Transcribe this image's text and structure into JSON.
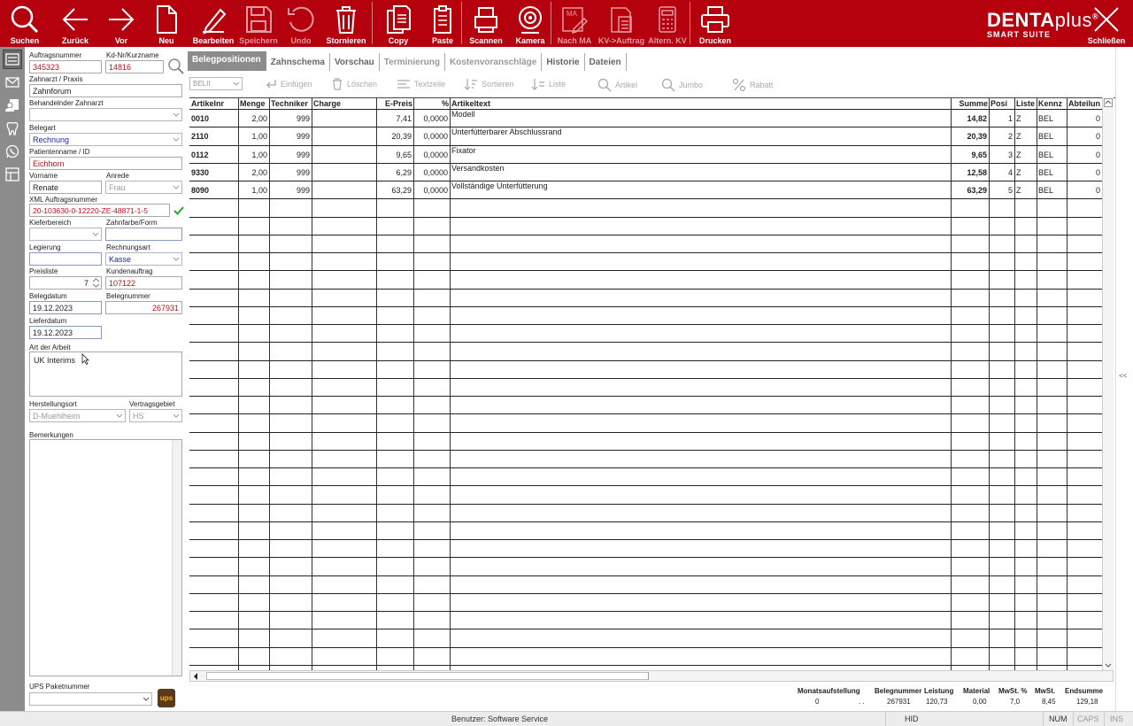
{
  "toolbar": {
    "items": [
      {
        "label": "Suchen"
      },
      {
        "label": "Zurück"
      },
      {
        "label": "Vor"
      },
      {
        "label": "Neu"
      },
      {
        "label": "Bearbeiten"
      },
      {
        "label": "Speichern"
      },
      {
        "label": "Undo"
      },
      {
        "label": "Stornieren"
      },
      {
        "label": "Copy"
      },
      {
        "label": "Paste"
      },
      {
        "label": "Scannen"
      },
      {
        "label": "Kamera"
      },
      {
        "label": "Nach MA"
      },
      {
        "label": "KV->Auftrag"
      },
      {
        "label": "Altern. KV"
      },
      {
        "label": "Drucken"
      },
      {
        "label": "Schließen"
      }
    ],
    "nach_ma_icon_text": "MA",
    "brand_main": "DENTA",
    "brand_plus": "plus",
    "brand_reg": "®",
    "brand_sub": "SMART SUITE"
  },
  "form": {
    "auftragsnummer_label": "Auftragsnummer",
    "auftragsnummer": "345323",
    "kdnr_label": "Kd-Nr/Kurzname",
    "kdnr": "14816",
    "zahnarzt_label": "Zahnarzt / Praxis",
    "zahnarzt": "Zahnforum",
    "behandelnder_label": "Behandelnder Zahnarzt",
    "behandelnder": "",
    "belegart_label": "Belegart",
    "belegart": "Rechnung",
    "patient_label": "Patientenname / ID",
    "patient": "Eichhorn",
    "vorname_label": "Vorname",
    "vorname": "Renate",
    "anrede_label": "Anrede",
    "anrede": "Frau",
    "xml_label": "XML Auftragsnummer",
    "xml": "20-103630-0-12220-ZE-48871-1-5",
    "kieferbereich_label": "Kieferbereich",
    "kieferbereich": "",
    "zahnfarbe_label": "Zahnfarbe/Form",
    "zahnfarbe": "",
    "legierung_label": "Legierung",
    "legierung": "",
    "rechnungsart_label": "Rechnungsart",
    "rechnungsart": "Kasse",
    "preisliste_label": "Preisliste",
    "preisliste": "7",
    "kundenauftrag_label": "Kundenauftrag",
    "kundenauftrag": "107122",
    "belegdatum_label": "Belegdatum",
    "belegdatum": "19.12.2023",
    "belegnummer_label": "Belegnummer",
    "belegnummer": "267931",
    "lieferdatum_label": "Lieferdatum",
    "lieferdatum": "19.12.2023",
    "art_label": "Art der Arbeit",
    "art": "UK Interims",
    "herstellungsort_label": "Herstellungsort",
    "herstellungsort": "D-Muehlheim",
    "vertragsgebiet_label": "Vertragsgebiet",
    "vertragsgebiet": "HS",
    "bemerkungen_label": "Bemerkungen",
    "bemerkungen": "",
    "ups_label": "UPS Paketnummer",
    "ups_value": "",
    "ups_logo": "ups"
  },
  "tabs": [
    "Belegpositionen",
    "Zahnschema",
    "Vorschau",
    "Terminierung",
    "Kostenvoranschläge",
    "Historie",
    "Dateien"
  ],
  "subtoolbar": {
    "select_value": "BELII",
    "items": [
      "Einfügen",
      "Löschen",
      "Textzeile",
      "Sortieren",
      "Liste",
      "Artikel",
      "Jumbo",
      "Rabatt"
    ]
  },
  "grid": {
    "headers": [
      "Artikelnr",
      "Menge",
      "Techniker",
      "Charge",
      "E-Preis",
      "%",
      "Artikeltext",
      "Summe",
      "Posi",
      "Liste",
      "Kennz",
      "Abteilun"
    ],
    "rows": [
      [
        "0010",
        "2,00",
        "999",
        "",
        "7,41",
        "0,0000",
        "Modell",
        "14,82",
        "1",
        "Z",
        "BEL",
        "0"
      ],
      [
        "2110",
        "1,00",
        "999",
        "",
        "20,39",
        "0,0000",
        "Unterfütterbarer Abschlussrand",
        "20,39",
        "2",
        "Z",
        "BEL",
        "0"
      ],
      [
        "0112",
        "1,00",
        "999",
        "",
        "9,65",
        "0,0000",
        "Fixator",
        "9,65",
        "3",
        "Z",
        "BEL",
        "0"
      ],
      [
        "9330",
        "2,00",
        "999",
        "",
        "6,29",
        "0,0000",
        "Versandkosten",
        "12,58",
        "4",
        "Z",
        "BEL",
        "0"
      ],
      [
        "8090",
        "1,00",
        "999",
        "",
        "63,29",
        "0,0000",
        "Vollständige Unterfütterung",
        "63,29",
        "5",
        "Z",
        "BEL",
        "0"
      ]
    ]
  },
  "summary": {
    "labels": [
      "Monatsaufstellung",
      "Belegnummer",
      "Leistung",
      "Material",
      "MwSt. %",
      "MwSt.",
      "Endsumme"
    ],
    "values": [
      "0",
      ". .",
      "267931",
      "120,73",
      "0,00",
      "7,0",
      "8,45",
      "129,18"
    ]
  },
  "statusbar": {
    "user": "Benutzer: Software Service",
    "hid": "HID",
    "num": "NUM",
    "caps": "CAPS",
    "ins": "INS"
  },
  "collapse_label": "<<",
  "colors": {
    "toolbar": "#b5000e",
    "sidebar": "#8c8c8c",
    "accent_red": "#c0101a",
    "accent_blue": "#1a2a9a"
  }
}
